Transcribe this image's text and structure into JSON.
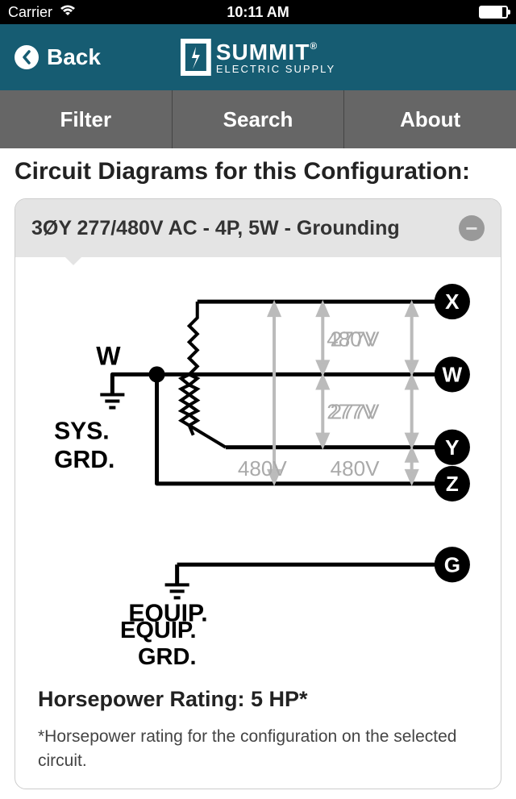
{
  "status": {
    "carrier": "Carrier",
    "time": "10:11 AM"
  },
  "nav": {
    "back": "Back",
    "brand_top": "SUMMIT",
    "brand_reg": "®",
    "brand_bottom": "ELECTRIC SUPPLY"
  },
  "tabs": {
    "filter": "Filter",
    "search": "Search",
    "about": "About"
  },
  "page": {
    "title": "Circuit Diagrams for this Configuration:"
  },
  "card": {
    "title": "3ØY 277/480V AC - 4P, 5W - Grounding"
  },
  "diagram": {
    "terminals": {
      "x": "X",
      "w": "W",
      "y": "Y",
      "z": "Z",
      "g": "G"
    },
    "labels": {
      "w_left": "W",
      "sys": "SYS.",
      "grd": "GRD.",
      "equip": "EQUIP.",
      "grd2": "GRD.",
      "v480": "480V",
      "v277": "277V"
    }
  },
  "hp": {
    "title": "Horsepower Rating: 5 HP*",
    "note": "*Horsepower rating for the configuration on the selected circuit."
  }
}
